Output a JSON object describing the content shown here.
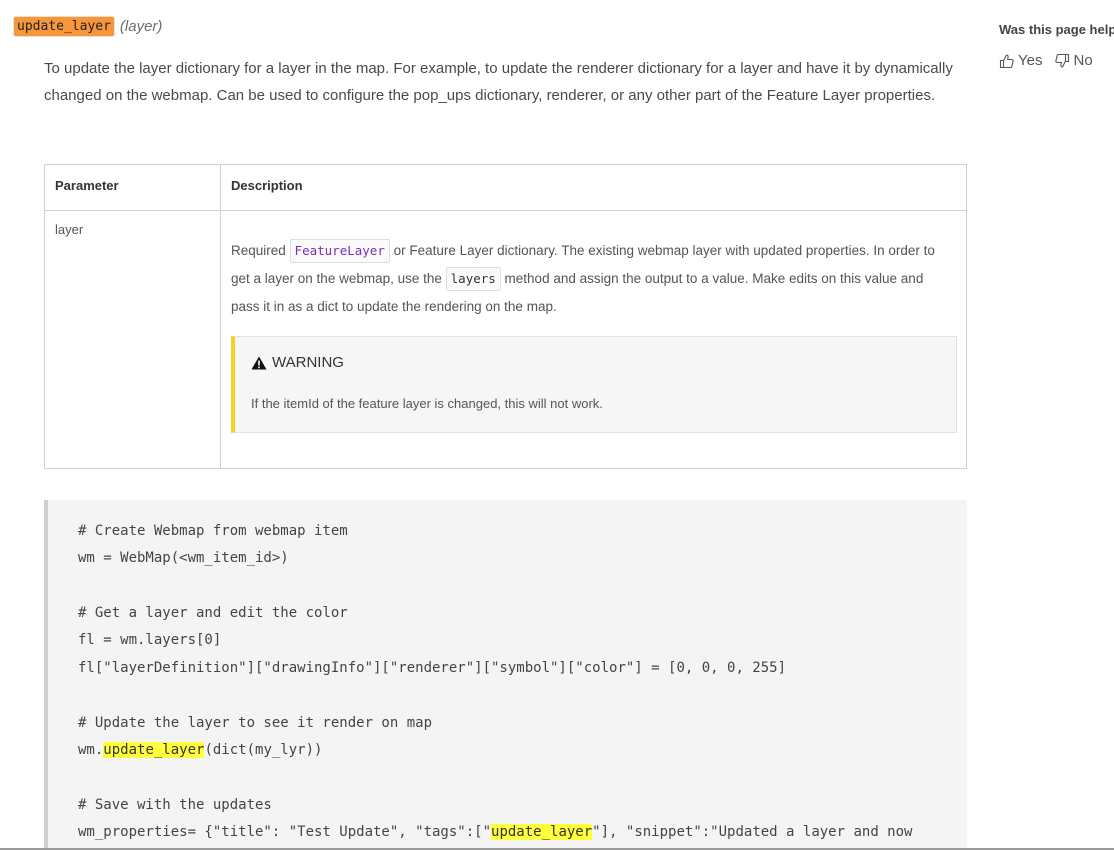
{
  "signature": {
    "name": "update_layer",
    "args": "(layer)"
  },
  "intro": "To update the layer dictionary for a layer in the map. For example, to update the renderer dictionary for a layer and have it by dynamically changed on the webmap. Can be used to configure the pop_ups dictionary, renderer, or any other part of the Feature Layer properties.",
  "table": {
    "headers": [
      "Parameter",
      "Description"
    ],
    "row": {
      "param": "layer",
      "desc_part1": "Required ",
      "chip1": "FeatureLayer",
      "desc_part2": " or Feature Layer dictionary. The existing webmap layer with updated properties. In order to get a layer on the webmap, use the ",
      "chip2": "layers",
      "desc_part3": " method and assign the output to a value. Make edits on this value and pass it in as a dict to update the rendering on the map.",
      "warning_title": "WARNING",
      "warning_text": "If the itemId of the feature layer is changed, this will not work."
    }
  },
  "code": {
    "l1": "# Create Webmap from webmap item",
    "l2": "wm = WebMap(<wm_item_id>)",
    "l3": "# Get a layer and edit the color",
    "l4": "fl = wm.layers[0]",
    "l5": "fl[\"layerDefinition\"][\"drawingInfo\"][\"renderer\"][\"symbol\"][\"color\"] = [0, 0, 0, 255]",
    "l6": "# Update the layer to see it render on map",
    "l7a": "wm.",
    "l7b": "update_layer",
    "l7c": "(dict(my_lyr))",
    "l8": "# Save with the updates",
    "l9a": "wm_properties= {\"title\": \"Test Update\", \"tags\":[\"",
    "l9b": "update_layer",
    "l9c": "\"], \"snippet\":\"Updated a layer and now"
  },
  "feedback": {
    "question": "Was this page helpful?",
    "yes": "Yes",
    "no": "No"
  },
  "colors": {
    "fn_highlight": "#f7963b",
    "search_highlight": "#ffff3a",
    "warning_bar": "#f7d026"
  }
}
